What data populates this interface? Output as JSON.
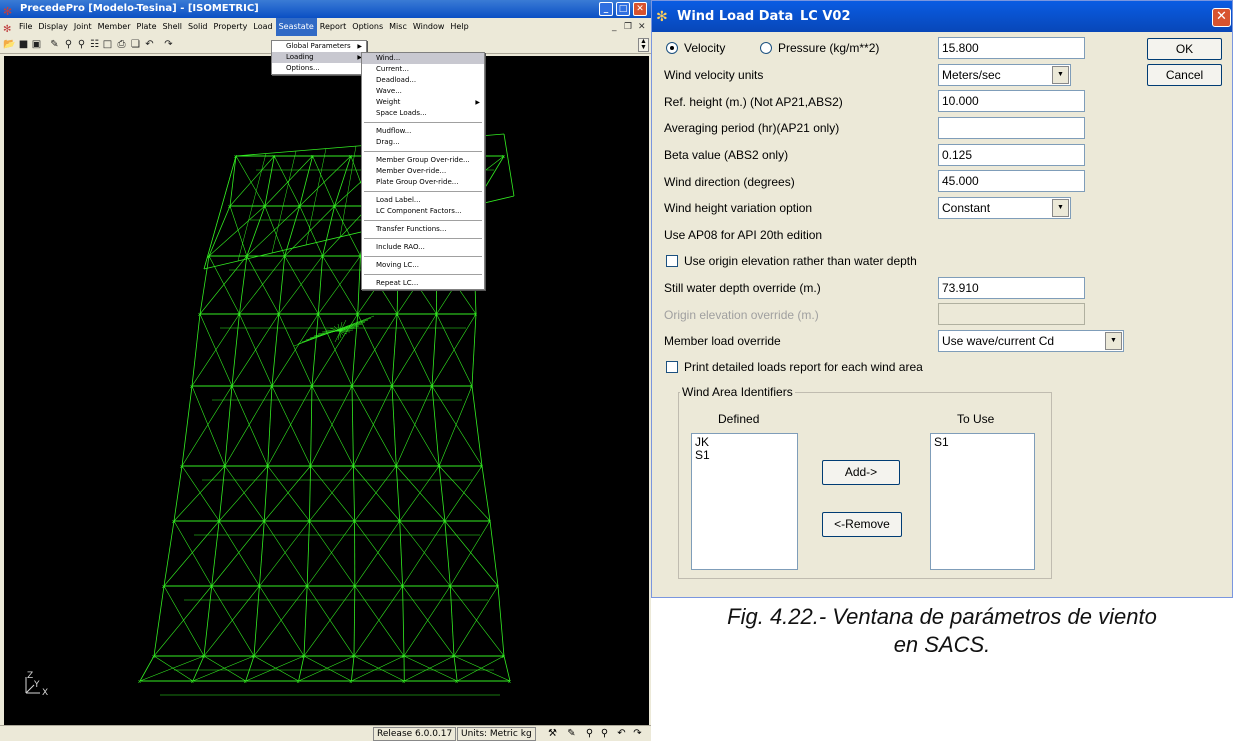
{
  "app": {
    "title": "PrecedePro  [Modelo-Tesina] - [ISOMETRIC]",
    "menu": [
      "File",
      "Display",
      "Joint",
      "Member",
      "Plate",
      "Shell",
      "Solid",
      "Property",
      "Load",
      "Seastate",
      "Report",
      "Options",
      "Misc",
      "Window",
      "Help"
    ],
    "active_menu": "Seastate",
    "seastate_menu": [
      {
        "label": "Global Parameters",
        "submenu": true
      },
      {
        "label": "Loading",
        "submenu": true,
        "selected": true
      },
      {
        "label": "Options..."
      }
    ],
    "loading_menu": [
      {
        "label": "Wind...",
        "selected": true
      },
      {
        "label": "Current..."
      },
      {
        "label": "Deadload..."
      },
      {
        "label": "Wave..."
      },
      {
        "label": "Weight",
        "submenu": true
      },
      {
        "label": "Space Loads..."
      },
      {
        "sep": true
      },
      {
        "label": "Mudflow..."
      },
      {
        "label": "Drag..."
      },
      {
        "sep": true
      },
      {
        "label": "Member Group Over-ride..."
      },
      {
        "label": "Member Over-ride..."
      },
      {
        "label": "Plate Group Over-ride..."
      },
      {
        "sep": true
      },
      {
        "label": "Load Label..."
      },
      {
        "label": "LC Component Factors..."
      },
      {
        "sep": true
      },
      {
        "label": "Transfer Functions..."
      },
      {
        "sep": true
      },
      {
        "label": "Include RAO..."
      },
      {
        "sep": true
      },
      {
        "label": "Moving LC..."
      },
      {
        "sep": true
      },
      {
        "label": "Repeat LC..."
      }
    ],
    "axis": {
      "x": "X",
      "y": "Y",
      "z": "Z"
    },
    "status": {
      "release": "Release 6.0.0.17",
      "units": "Units: Metric kg"
    },
    "model_color": "#33ee22",
    "background_color": "#000000"
  },
  "dialog": {
    "title": "Wind Load Data",
    "lc": "LC V02",
    "velocity_label": "Velocity",
    "pressure_label": "Pressure (kg/m**2)",
    "velocity_selected": true,
    "velocity_value": "15.800",
    "units_label": "Wind velocity units",
    "units_value": "Meters/sec",
    "ref_height_label": "Ref. height (m.) (Not AP21,ABS2)",
    "ref_height_value": "10.000",
    "avg_period_label": "Averaging period (hr)(AP21 only)",
    "avg_period_value": "",
    "beta_label": "Beta value (ABS2 only)",
    "beta_value": "0.125",
    "direction_label": "Wind direction (degrees)",
    "direction_value": "45.000",
    "height_var_label": "Wind height variation option",
    "height_var_value": "Constant",
    "ap08_text": "Use AP08 for API 20th edition",
    "origin_elev_check_label": "Use origin elevation rather than water depth",
    "still_water_label": "Still water depth override (m.)",
    "still_water_value": "73.910",
    "origin_override_label": "Origin elevation override (m.)",
    "origin_override_value": "",
    "member_override_label": "Member load override",
    "member_override_value": "Use wave/current Cd",
    "print_report_label": "Print detailed loads report for each wind area",
    "group_title": "Wind Area Identifiers",
    "defined_label": "Defined",
    "to_use_label": "To Use",
    "defined_items": [
      "JK",
      "S1"
    ],
    "to_use_items": [
      "S1"
    ],
    "add_label": "Add->",
    "remove_label": "<-Remove",
    "ok_label": "OK",
    "cancel_label": "Cancel",
    "title_color": "#0a5ce3"
  },
  "caption": {
    "line1": "Fig. 4.22.- Ventana de parámetros de viento",
    "line2": "en SACS."
  }
}
